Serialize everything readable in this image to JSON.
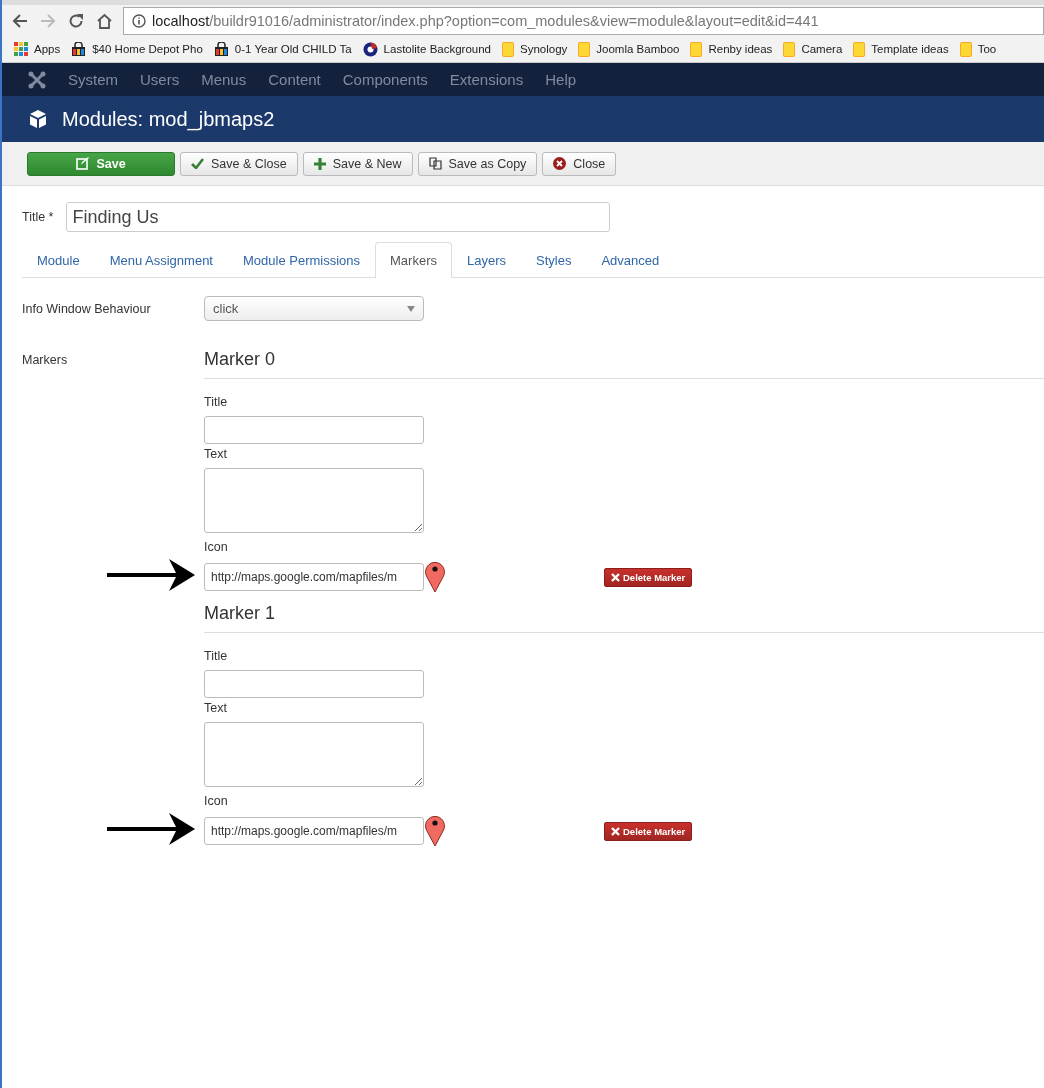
{
  "browser": {
    "url_host": "localhost",
    "url_path": "/buildr91016/administrator/index.php?option=com_modules&view=module&layout=edit&id=441",
    "bookmarks": [
      {
        "label": "Apps",
        "kind": "apps"
      },
      {
        "label": "$40 Home Depot Pho",
        "kind": "bag"
      },
      {
        "label": "0-1 Year Old CHILD Ta",
        "kind": "bag"
      },
      {
        "label": "Lastolite Background",
        "kind": "lens"
      },
      {
        "label": "Synology",
        "kind": "folder"
      },
      {
        "label": "Joomla Bamboo",
        "kind": "folder"
      },
      {
        "label": "Renby ideas",
        "kind": "folder"
      },
      {
        "label": "Camera",
        "kind": "folder"
      },
      {
        "label": "Template ideas",
        "kind": "folder"
      },
      {
        "label": "Too",
        "kind": "folder"
      }
    ]
  },
  "menu": [
    "System",
    "Users",
    "Menus",
    "Content",
    "Components",
    "Extensions",
    "Help"
  ],
  "header": {
    "title": "Modules: mod_jbmaps2"
  },
  "toolbar": [
    {
      "label": "Save",
      "kind": "save"
    },
    {
      "label": "Save & Close",
      "kind": "check"
    },
    {
      "label": "Save & New",
      "kind": "plus"
    },
    {
      "label": "Save as Copy",
      "kind": "copy"
    },
    {
      "label": "Close",
      "kind": "close"
    }
  ],
  "title_field": {
    "label": "Title *",
    "value": "Finding Us"
  },
  "tabs": [
    {
      "label": "Module",
      "selected": false
    },
    {
      "label": "Menu Assignment",
      "selected": false
    },
    {
      "label": "Module Permissions",
      "selected": false
    },
    {
      "label": "Markers",
      "selected": true
    },
    {
      "label": "Layers",
      "selected": false
    },
    {
      "label": "Styles",
      "selected": false
    },
    {
      "label": "Advanced",
      "selected": false
    }
  ],
  "info_window": {
    "label": "Info Window Behaviour",
    "value": "click"
  },
  "markers_label": "Markers",
  "markers": [
    {
      "heading": "Marker 0",
      "title_label": "Title",
      "text_label": "Text",
      "icon_label": "Icon",
      "icon_value": "http://maps.google.com/mapfiles/m",
      "delete": "Delete Marker"
    },
    {
      "heading": "Marker 1",
      "title_label": "Title",
      "text_label": "Text",
      "icon_label": "Icon",
      "icon_value": "http://maps.google.com/mapfiles/m",
      "delete": "Delete Marker"
    }
  ]
}
